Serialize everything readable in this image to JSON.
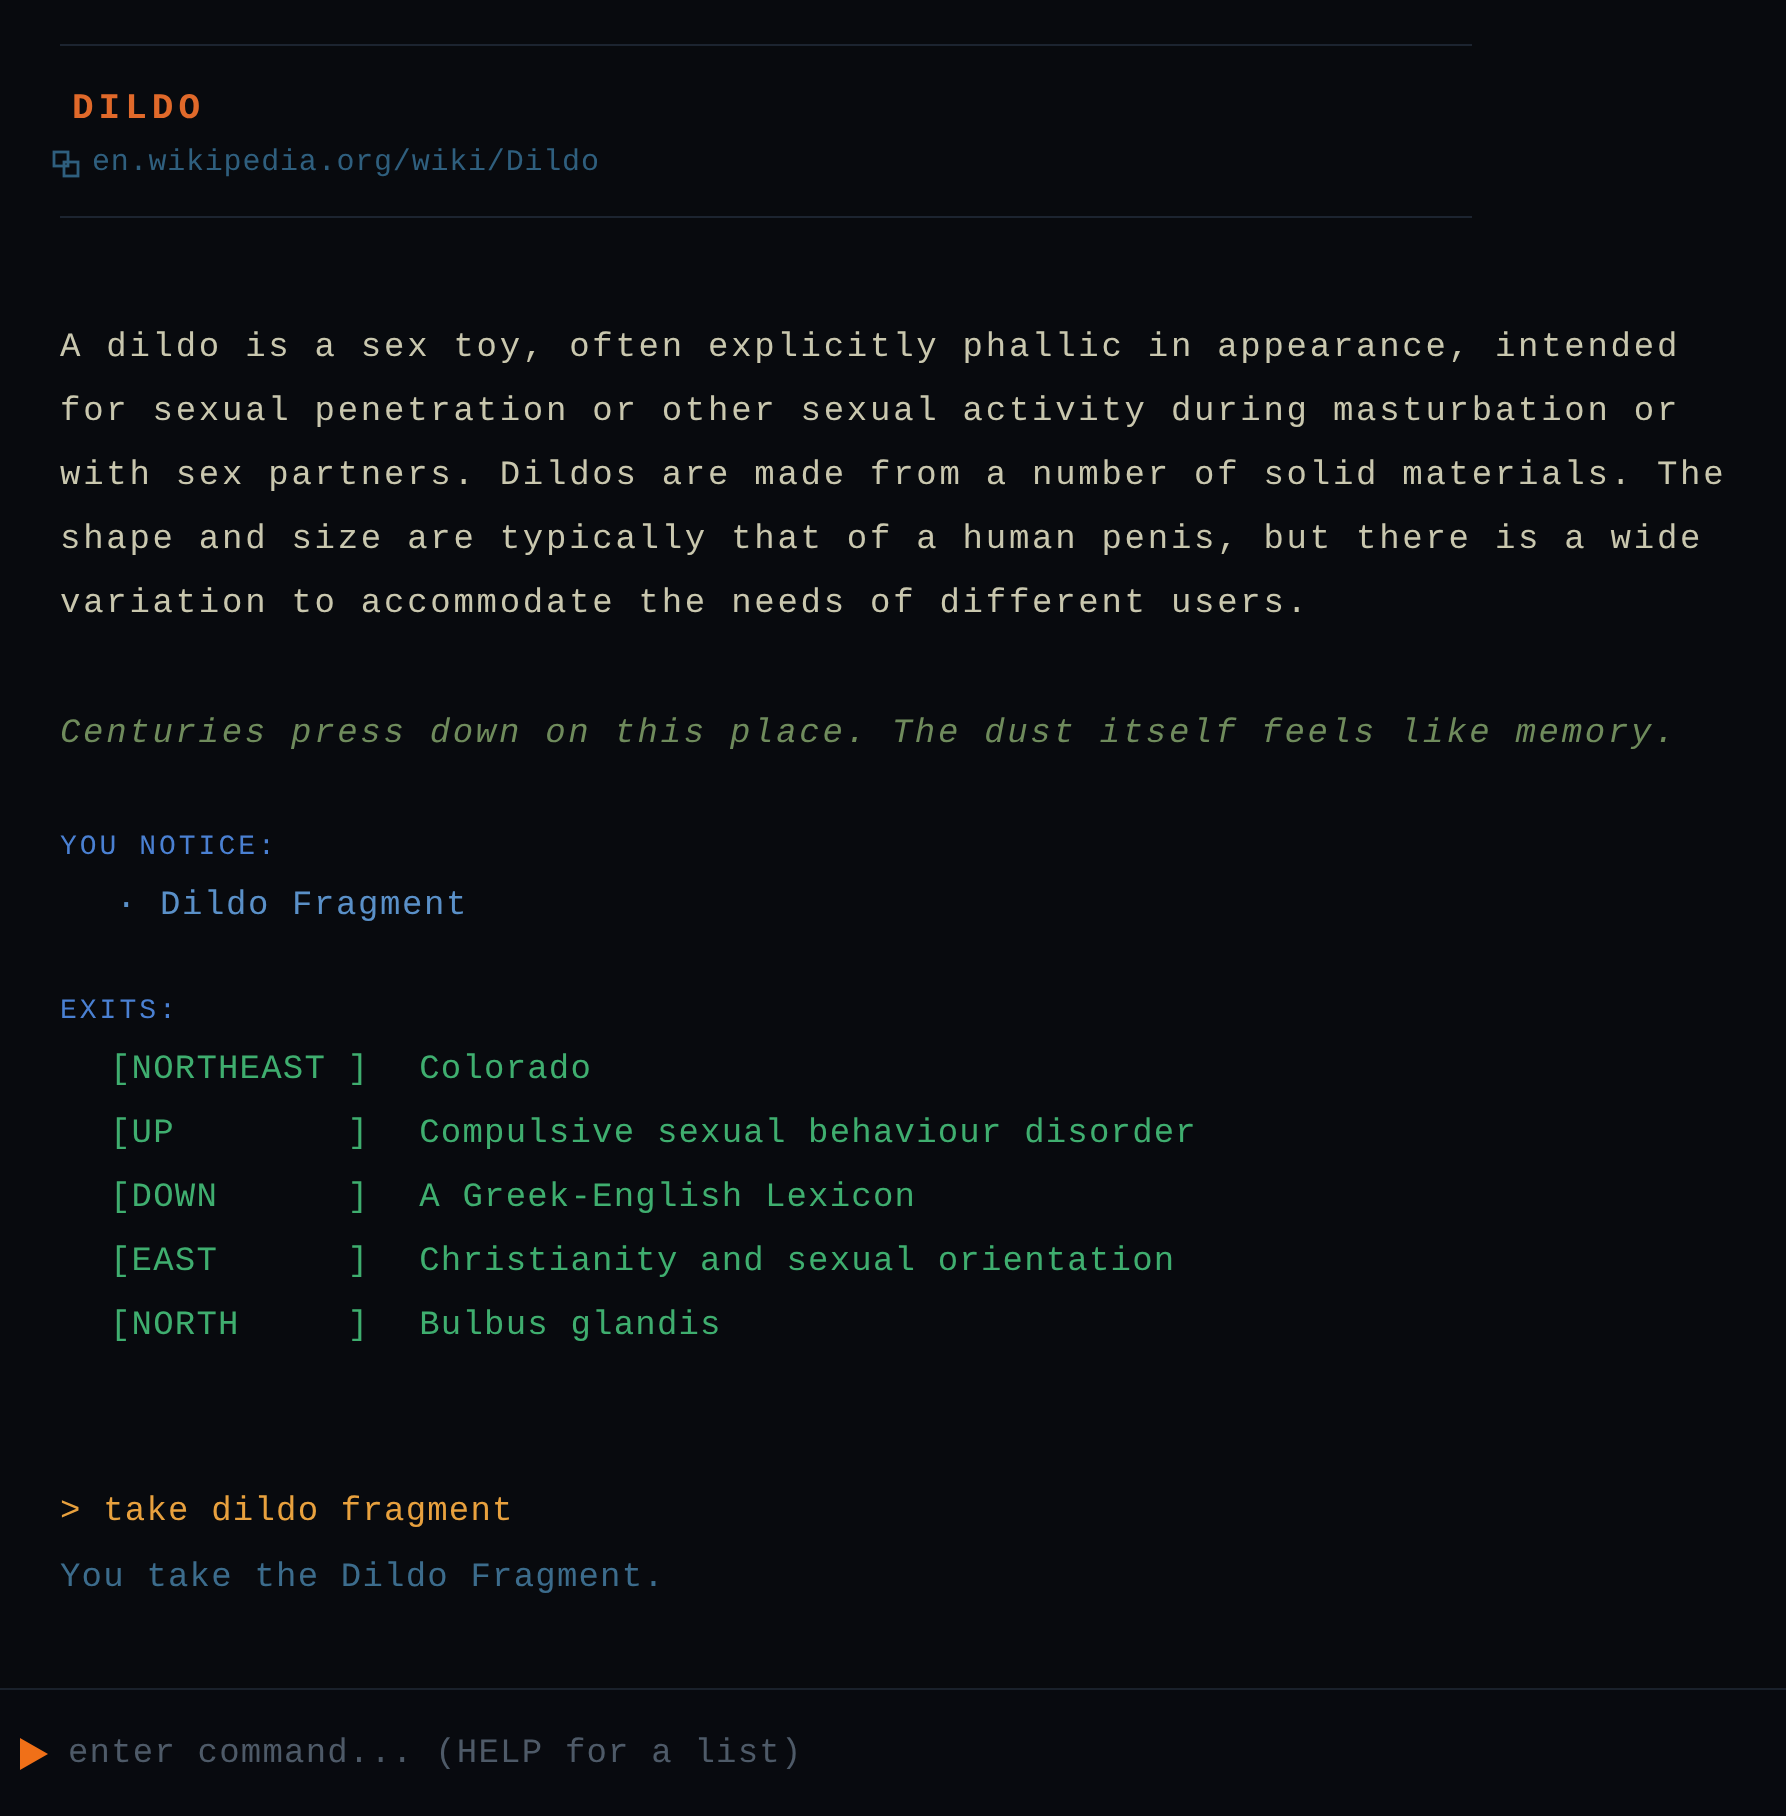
{
  "article": {
    "title": "DILDO",
    "source": "en.wikipedia.org/wiki/Dildo"
  },
  "description": "A dildo is a sex toy, often explicitly phallic in appearance, intended for sexual penetration or other sexual activity during masturbation or with sex partners. Dildos are made from a number of solid materials. The shape and size are typically that of a human penis, but there is a wide variation to accommodate the needs of different users.",
  "atmosphere": "Centuries press down on this place. The dust itself feels like memory.",
  "notice": {
    "heading": "YOU NOTICE:",
    "items": [
      "· Dildo Fragment"
    ]
  },
  "exits": {
    "heading": "EXITS:",
    "items": [
      {
        "direction": "[NORTHEAST ]",
        "destination": "Colorado"
      },
      {
        "direction": "[UP        ]",
        "destination": "Compulsive sexual behaviour disorder"
      },
      {
        "direction": "[DOWN      ]",
        "destination": "A Greek-English Lexicon"
      },
      {
        "direction": "[EAST      ]",
        "destination": "Christianity and sexual orientation"
      },
      {
        "direction": "[NORTH     ]",
        "destination": "Bulbus glandis"
      }
    ]
  },
  "log": [
    {
      "kind": "command",
      "text": "> take dildo fragment"
    },
    {
      "kind": "response",
      "text": "You take the Dildo Fragment."
    }
  ],
  "input": {
    "placeholder": "enter command... (HELP for a list)"
  }
}
